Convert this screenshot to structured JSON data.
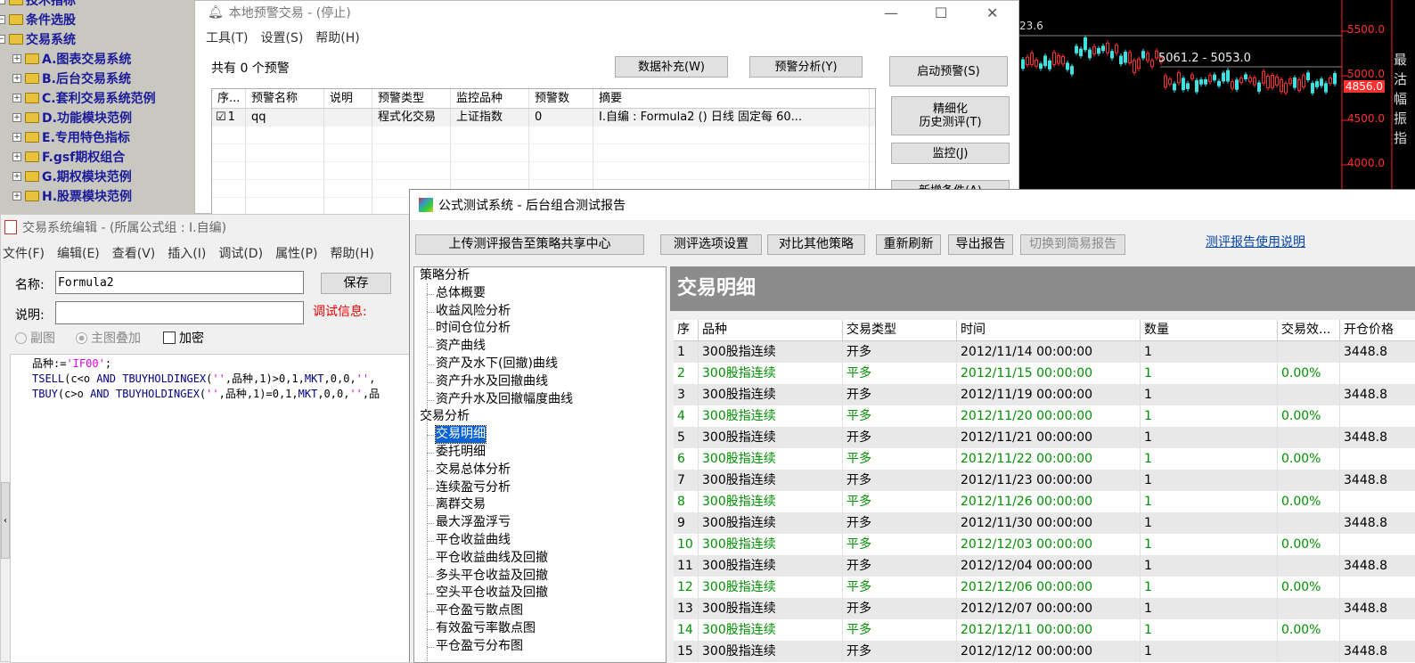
{
  "tree": {
    "items": [
      {
        "label": "技术指标",
        "level": 0
      },
      {
        "label": "条件选股",
        "level": 0
      },
      {
        "label": "交易系统",
        "level": 0
      },
      {
        "label": "A.图表交易系统",
        "level": 1
      },
      {
        "label": "B.后台交易系统",
        "level": 1
      },
      {
        "label": "C.套利交易系统范例",
        "level": 1
      },
      {
        "label": "D.功能模块范例",
        "level": 1
      },
      {
        "label": "E.专用特色指标",
        "level": 1
      },
      {
        "label": "F.gsf期权组合",
        "level": 1
      },
      {
        "label": "G.期权模块范例",
        "level": 1
      },
      {
        "label": "H.股票模块范例",
        "level": 1
      }
    ]
  },
  "alert_window": {
    "title": "本地预警交易 - (停止)",
    "menu": [
      "工具(T)",
      "设置(S)",
      "帮助(H)"
    ],
    "count_text": "共有 0 个预警",
    "buttons": {
      "data_fill": "数据补充(W)",
      "alert_analysis": "预警分析(Y)",
      "start_alert": "启动预警(S)",
      "fine_backtest_line1": "精细化",
      "fine_backtest_line2": "历史测评(T)",
      "monitor": "监控(J)",
      "add_condition": "新增条件(A)"
    },
    "columns": [
      "序...",
      "预警名称",
      "说明",
      "预警类型",
      "监控品种",
      "预警数",
      "摘要"
    ],
    "rows": [
      {
        "seq": "1",
        "name": "qq",
        "desc": "",
        "type": "程式化交易",
        "symbol": "上证指数",
        "count": "0",
        "summary": "I.自编 : Formula2 () 日线 固定每 60..."
      }
    ]
  },
  "chart": {
    "labels": {
      "top_left": "23.6",
      "range": "5061.2 - 5053.0",
      "p5500": "5500.0",
      "p5000": "5000.0",
      "p4856": "4856.0",
      "p4500": "4500.0",
      "p4000": "4000.0"
    },
    "side_chars": [
      "最",
      "沽",
      "幅",
      "振",
      "指"
    ]
  },
  "editor": {
    "title": "交易系统编辑 - (所属公式组 : I.自编)",
    "menu": [
      "文件(F)",
      "编辑(E)",
      "查看(V)",
      "插入(I)",
      "调试(D)",
      "属性(P)",
      "帮助(H)"
    ],
    "name_label": "名称:",
    "name_value": "Formula2",
    "save_label": "保存",
    "desc_label": "说明:",
    "debug_label": "调试信息:",
    "radio_sub": "副图",
    "radio_main": "主图叠加",
    "encrypt": "加密",
    "code_lines": [
      "品种:='IF00';",
      "TSELL(c<o AND TBUYHOLDINGEX('',品种,1)>0,1,MKT,0,0,'',",
      "TBUY(c>o AND TBUYHOLDINGEX('',品种,1)=0,1,MKT,0,0,'',品"
    ]
  },
  "report": {
    "title": "公式测试系统 - 后台组合测试报告",
    "buttons": {
      "upload": "上传测评报告至策略共享中心",
      "options": "测评选项设置",
      "compare": "对比其他策略",
      "refresh": "重新刷新",
      "export": "导出报告",
      "simple": "切换到简易报告"
    },
    "help_link": "测评报告使用说明",
    "nav": [
      {
        "label": "策略分析",
        "level": 0
      },
      {
        "label": "总体概要",
        "level": 1
      },
      {
        "label": "收益风险分析",
        "level": 1
      },
      {
        "label": "时间仓位分析",
        "level": 1
      },
      {
        "label": "资产曲线",
        "level": 1
      },
      {
        "label": "资产及水下(回撤)曲线",
        "level": 1
      },
      {
        "label": "资产升水及回撤曲线",
        "level": 1
      },
      {
        "label": "资产升水及回撤幅度曲线",
        "level": 1
      },
      {
        "label": "交易分析",
        "level": 0
      },
      {
        "label": "交易明细",
        "level": 1,
        "selected": true
      },
      {
        "label": "委托明细",
        "level": 1
      },
      {
        "label": "交易总体分析",
        "level": 1
      },
      {
        "label": "连续盈亏分析",
        "level": 1
      },
      {
        "label": "离群交易",
        "level": 1
      },
      {
        "label": "最大浮盈浮亏",
        "level": 1
      },
      {
        "label": "平仓收益曲线",
        "level": 1
      },
      {
        "label": "平仓收益曲线及回撤",
        "level": 1
      },
      {
        "label": "多头平仓收益及回撤",
        "level": 1
      },
      {
        "label": "空头平仓收益及回撤",
        "level": 1
      },
      {
        "label": "平仓盈亏散点图",
        "level": 1
      },
      {
        "label": "有效盈亏率散点图",
        "level": 1
      },
      {
        "label": "平仓盈亏分布图",
        "level": 1
      }
    ],
    "section_title": "交易明细",
    "columns": [
      "序",
      "品种",
      "交易类型",
      "时间",
      "数量",
      "交易效...",
      "开仓价格"
    ],
    "rows": [
      [
        "1",
        "300股指连续",
        "开多",
        "2012/11/14 00:00:00",
        "1",
        "",
        "3448.8"
      ],
      [
        "2",
        "300股指连续",
        "平多",
        "2012/11/15 00:00:00",
        "1",
        "0.00%",
        ""
      ],
      [
        "3",
        "300股指连续",
        "开多",
        "2012/11/19 00:00:00",
        "1",
        "",
        "3448.8"
      ],
      [
        "4",
        "300股指连续",
        "平多",
        "2012/11/20 00:00:00",
        "1",
        "0.00%",
        ""
      ],
      [
        "5",
        "300股指连续",
        "开多",
        "2012/11/21 00:00:00",
        "1",
        "",
        "3448.8"
      ],
      [
        "6",
        "300股指连续",
        "平多",
        "2012/11/22 00:00:00",
        "1",
        "0.00%",
        ""
      ],
      [
        "7",
        "300股指连续",
        "开多",
        "2012/11/23 00:00:00",
        "1",
        "",
        "3448.8"
      ],
      [
        "8",
        "300股指连续",
        "平多",
        "2012/11/26 00:00:00",
        "1",
        "0.00%",
        ""
      ],
      [
        "9",
        "300股指连续",
        "开多",
        "2012/11/30 00:00:00",
        "1",
        "",
        "3448.8"
      ],
      [
        "10",
        "300股指连续",
        "平多",
        "2012/12/03 00:00:00",
        "1",
        "0.00%",
        ""
      ],
      [
        "11",
        "300股指连续",
        "开多",
        "2012/12/04 00:00:00",
        "1",
        "",
        "3448.8"
      ],
      [
        "12",
        "300股指连续",
        "平多",
        "2012/12/06 00:00:00",
        "1",
        "0.00%",
        ""
      ],
      [
        "13",
        "300股指连续",
        "开多",
        "2012/12/07 00:00:00",
        "1",
        "",
        "3448.8"
      ],
      [
        "14",
        "300股指连续",
        "平多",
        "2012/12/11 00:00:00",
        "1",
        "0.00%",
        ""
      ],
      [
        "15",
        "300股指连续",
        "开多",
        "2012/12/12 00:00:00",
        "1",
        "",
        "3448.8"
      ]
    ]
  }
}
